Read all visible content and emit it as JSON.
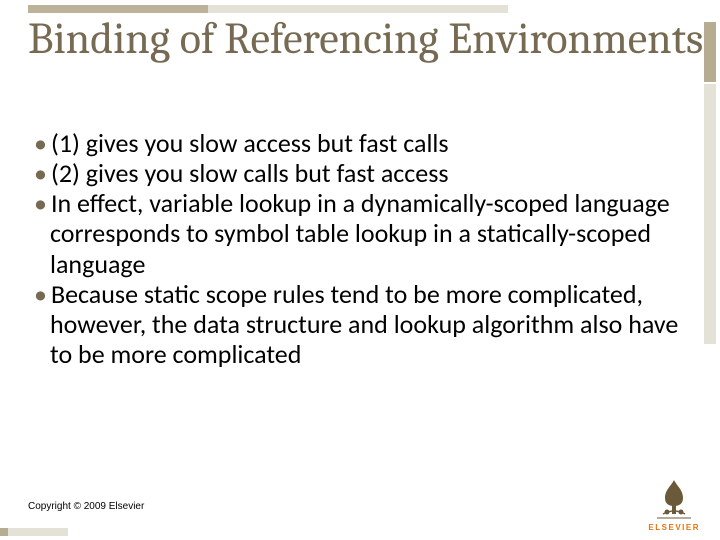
{
  "title": "Binding of Referencing Environments",
  "bullets": {
    "b1": "(1) gives you slow access but fast calls",
    "b2": "(2) gives you slow calls but fast access",
    "b3": "In effect, variable lookup in a dynamically-scoped language corresponds to symbol table lookup in a statically-scoped language",
    "b4": "Because static scope rules tend to be more complicated, however, the data structure and lookup algorithm also have to be more complicated"
  },
  "copyright": "Copyright © 2009 Elsevier",
  "logo": {
    "label": "ELSEVIER"
  }
}
